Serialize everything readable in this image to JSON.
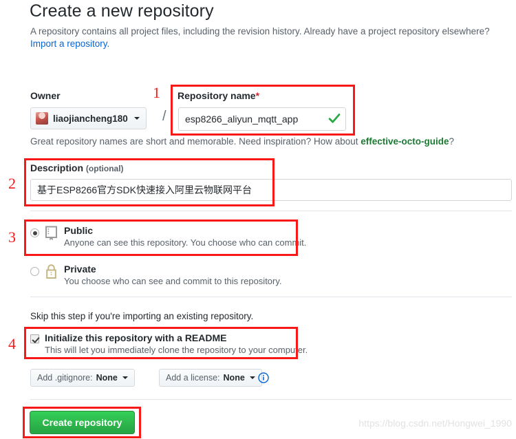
{
  "page": {
    "title": "Create a new repository",
    "subtitle": "A repository contains all project files, including the revision history. Already have a project repository elsewhere?",
    "import_link": "Import a repository."
  },
  "owner": {
    "label": "Owner",
    "name": "liaojiancheng180",
    "avatar_icon": "user-avatar",
    "caret_icon": "chevron-down-icon",
    "separator": "/"
  },
  "repo_name": {
    "label": "Repository name",
    "required_marker": "*",
    "value": "esp8266_aliyun_mqtt_app",
    "placeholder": "",
    "valid_icon": "check-icon",
    "hint_prefix": "Great repository names are short and memorable. Need inspiration? How about ",
    "hint_suggestion": "effective-octo-guide",
    "hint_suffix": "?"
  },
  "description": {
    "label": "Description",
    "optional_label": "(optional)",
    "value": "基于ESP8266官方SDK快速接入阿里云物联网平台",
    "placeholder": ""
  },
  "visibility": {
    "options": [
      {
        "id": "public",
        "title": "Public",
        "description": "Anyone can see this repository. You choose who can commit.",
        "icon": "book-icon",
        "selected": true
      },
      {
        "id": "private",
        "title": "Private",
        "description": "You choose who can see and commit to this repository.",
        "icon": "lock-icon",
        "selected": false
      }
    ]
  },
  "initialize": {
    "skip_text": "Skip this step if you're importing an existing repository.",
    "checkbox_label": "Initialize this repository with a README",
    "checkbox_description": "This will let you immediately clone the repository to your computer.",
    "checked": true
  },
  "selects": {
    "gitignore_prefix": "Add .gitignore: ",
    "gitignore_value": "None",
    "license_prefix": "Add a license: ",
    "license_value": "None",
    "info_icon": "info-icon"
  },
  "submit": {
    "label": "Create repository"
  },
  "annotations": {
    "numbers": [
      "1",
      "2",
      "3",
      "4"
    ],
    "box_color": "#f71818"
  },
  "watermark": {
    "text": "https://blog.csdn.net/Hongwei_1990"
  }
}
